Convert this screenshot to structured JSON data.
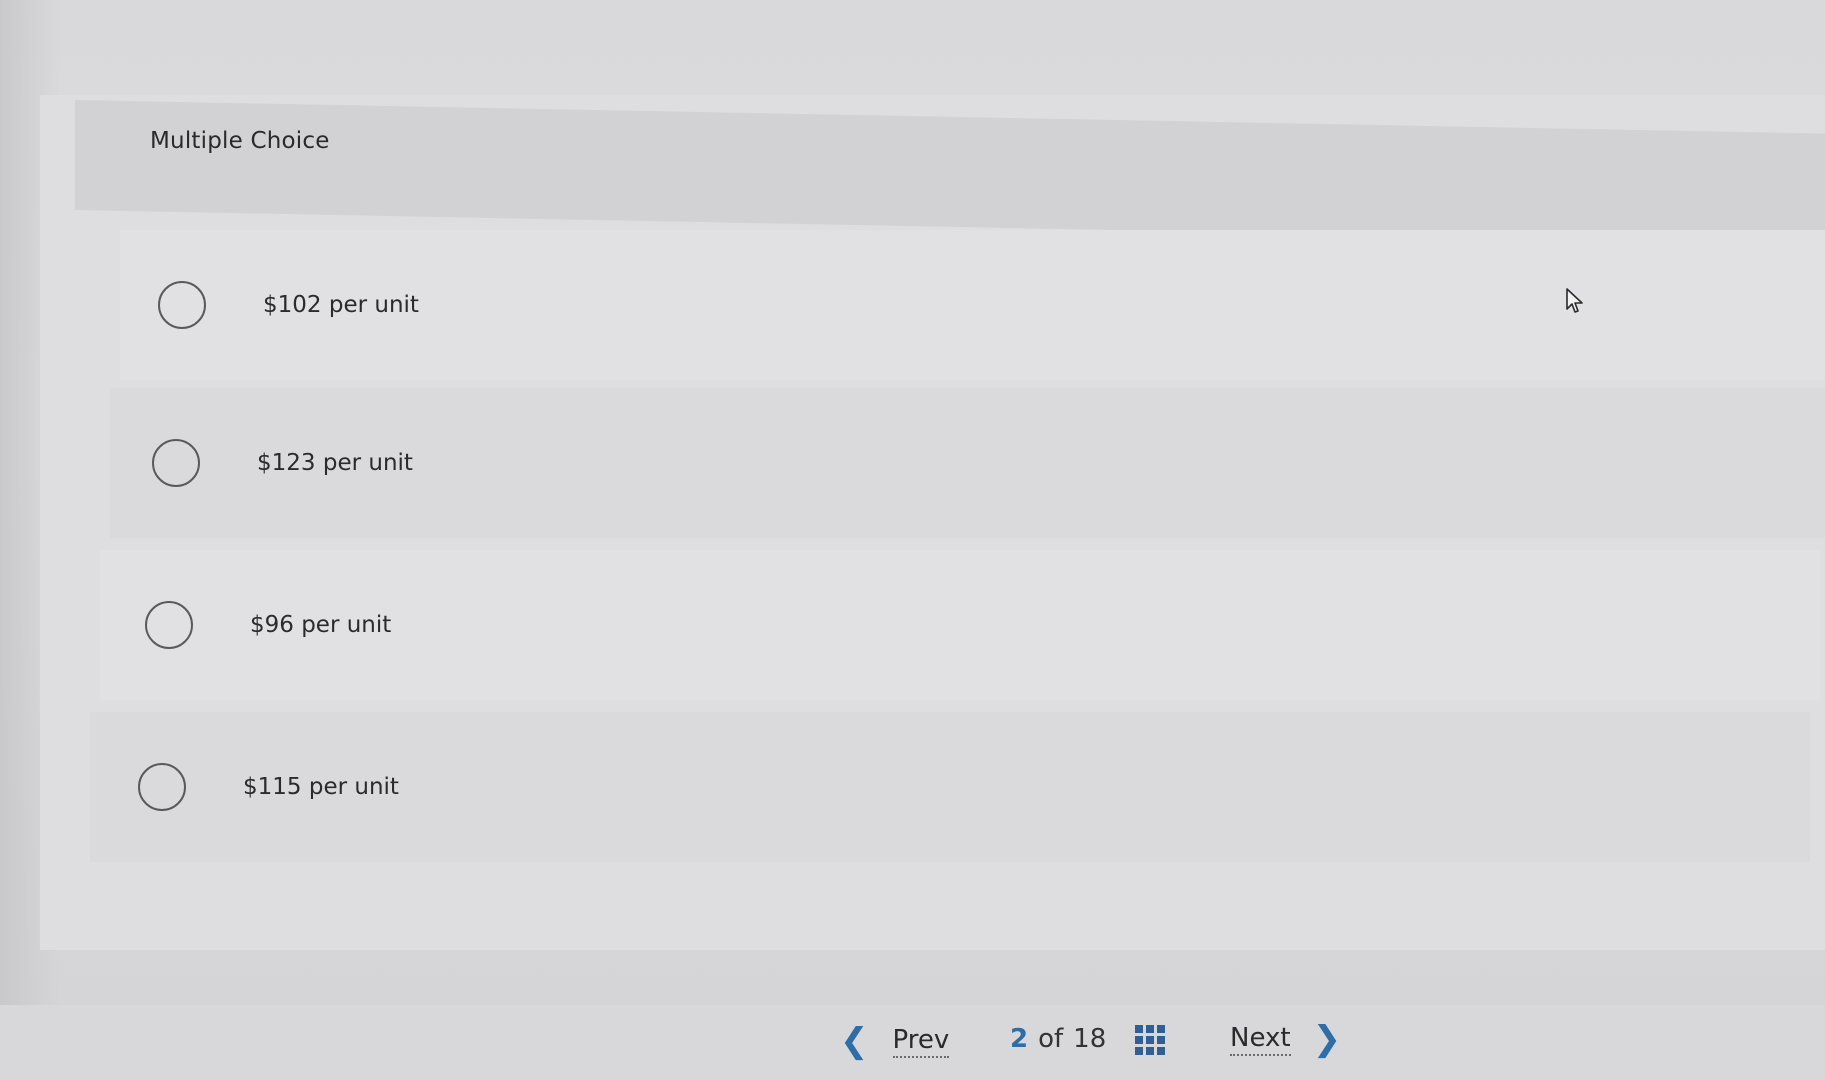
{
  "section": {
    "title": "Multiple Choice"
  },
  "question": {
    "options": [
      {
        "label": "$102 per unit",
        "selected": false
      },
      {
        "label": "$123 per unit",
        "selected": false
      },
      {
        "label": "$96 per unit",
        "selected": false
      },
      {
        "label": "$115 per unit",
        "selected": false
      }
    ]
  },
  "navigation": {
    "prev_label": "Prev",
    "next_label": "Next",
    "current_page": "2",
    "separator": "of",
    "total_pages": "18",
    "prev_icon": "chevron-left-icon",
    "next_icon": "chevron-right-icon",
    "grid_icon": "question-grid-icon"
  },
  "colors": {
    "accent": "#2c6ea8",
    "grid_icon": "#2f5f96",
    "text": "#2b2b2b",
    "radio_border": "#5a5a5a"
  }
}
